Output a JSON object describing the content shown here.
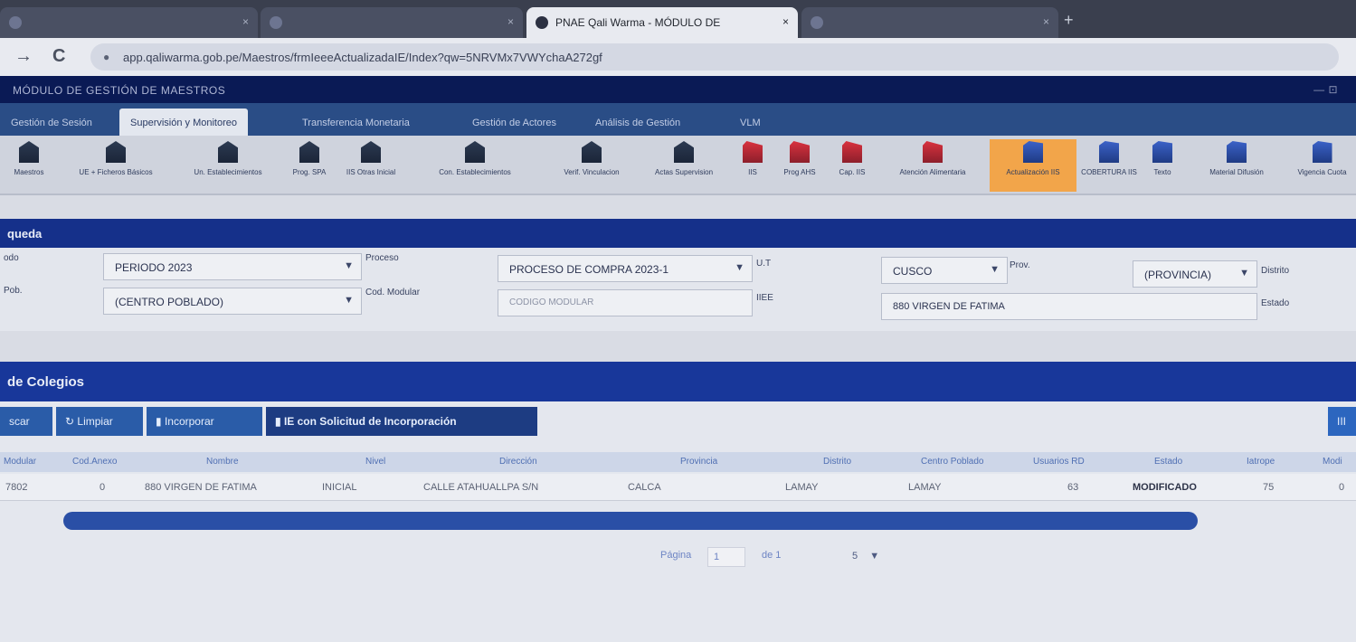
{
  "browser": {
    "tabs": [
      {
        "label": "",
        "active": false
      },
      {
        "label": "",
        "active": false
      },
      {
        "label": "PNAE Qali Warma - MÓDULO DE",
        "active": true
      },
      {
        "label": "",
        "active": false
      }
    ],
    "tab_close": "×",
    "new_tab": "+",
    "back": "→",
    "reload": "C",
    "url": "app.qaliwarma.gob.pe/Maestros/frmIeeeActualizadaIE/Index?qw=5NRVMx7VWYchaA272gf"
  },
  "app": {
    "title": "MÓDULO DE GESTIÓN DE MAESTROS",
    "window_controls": "—   ⊡",
    "menu": [
      "Gestión de Sesión",
      "Supervisión y Monitoreo",
      "Transferencia Monetaria",
      "Gestión de Actores",
      "Análisis de Gestión",
      "VLM"
    ],
    "toolbar": [
      {
        "label": "Maestros",
        "icon": "building"
      },
      {
        "label": "UE + Ficheros Básicos",
        "icon": "building"
      },
      {
        "label": "Un. Establecimientos",
        "icon": "building"
      },
      {
        "label": "Prog. SPA",
        "icon": "building"
      },
      {
        "label": "IIS Otras Inicial",
        "icon": "building"
      },
      {
        "label": "Con. Establecimientos",
        "icon": "building"
      },
      {
        "label": "Verif. Vinculacion",
        "icon": "building"
      },
      {
        "label": "Actas Supervision",
        "icon": "building"
      },
      {
        "label": "IIS",
        "icon": "red"
      },
      {
        "label": "Prog AHS",
        "icon": "red"
      },
      {
        "label": "Cap. IIS",
        "icon": "red"
      },
      {
        "label": "Atención Alimentaria",
        "icon": "red"
      },
      {
        "label": "Actualización IIS",
        "icon": "blue",
        "active": true
      },
      {
        "label": "COBERTURA IIS",
        "icon": "blue"
      },
      {
        "label": "Texto",
        "icon": "blue"
      },
      {
        "label": "Material Difusión",
        "icon": "blue"
      },
      {
        "label": "Vigencia Cuota",
        "icon": "blue"
      }
    ],
    "search_section": "queda",
    "form": {
      "periodo_label": "odo",
      "periodo_value": "PERIODO 2023",
      "proceso_label": "Proceso",
      "proceso_value": "PROCESO DE COMPRA 2023-1",
      "ut_label": "U.T",
      "ut_value": "CUSCO",
      "prov_label": "Prov.",
      "prov_value": "(PROVINCIA)",
      "distrito_label": "Distrito",
      "cpob_label": "Pob.",
      "cpob_value": "(CENTRO POBLADO)",
      "codmod_label": "Cod. Modular",
      "codmod_placeholder": "CODIGO MODULAR",
      "iee_label": "IIEE",
      "iee_value": "880 VIRGEN DE FATIMA",
      "estado_label": "Estado"
    },
    "grid_section": "de Colegios",
    "buttons": {
      "buscar": "scar",
      "limpiar": "Limpiar",
      "incorporar": "Incorporar",
      "solicitud": "IE con Solicitud de Incorporación",
      "right": "III"
    },
    "columns": [
      "Modular",
      "Cod.Anexo",
      "Nombre",
      "Nivel",
      "Dirección",
      "Provincia",
      "Distrito",
      "Centro Poblado",
      "Usuarios RD",
      "Estado",
      "Iatrope",
      "Modi"
    ],
    "rows": [
      {
        "modular": "7802",
        "anexo": "0",
        "nombre": "880 VIRGEN DE FATIMA",
        "nivel": "INICIAL",
        "direccion": "CALLE ATAHUALLPA S/N",
        "provincia": "CALCA",
        "distrito": "LAMAY",
        "cpoblado": "LAMAY",
        "usuarios": "63",
        "estado": "MODIFICADO",
        "iatrope": "75",
        "modi": "0"
      }
    ],
    "pager": {
      "pagina": "Página",
      "page": "1",
      "de": "de 1",
      "size": "5"
    }
  }
}
